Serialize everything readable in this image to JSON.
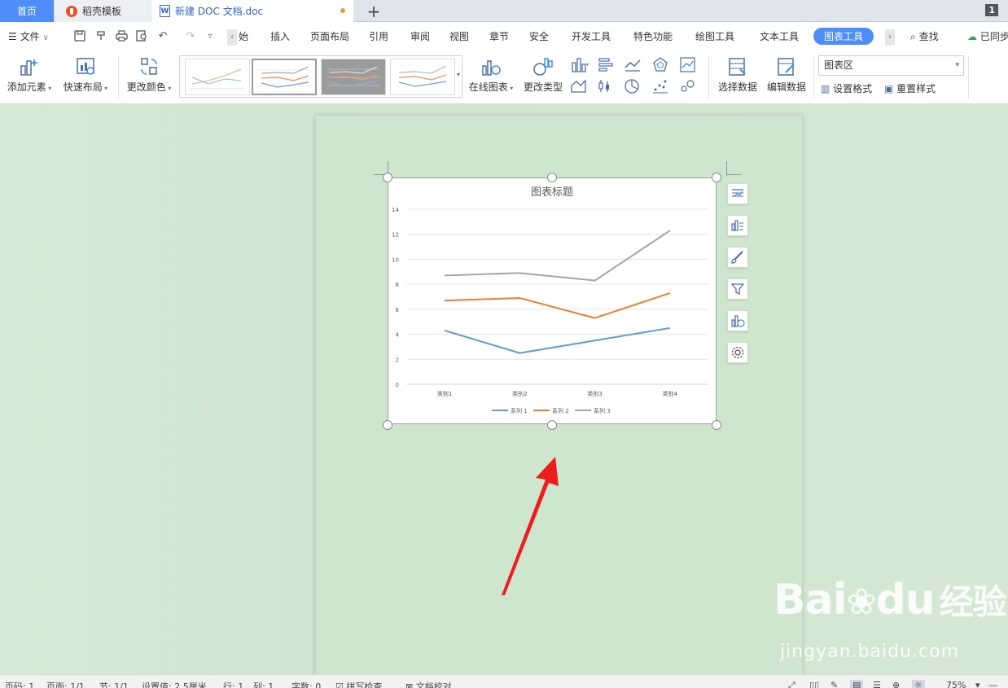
{
  "tabs": {
    "home": "首页",
    "template": "稻壳模板",
    "document": "新建 DOC 文档.doc",
    "add": "+",
    "window_count": "1"
  },
  "menu": {
    "file": "文件",
    "items": [
      "始",
      "插入",
      "页面布局",
      "引用",
      "审阅",
      "视图",
      "章节",
      "安全",
      "开发工具",
      "特色功能",
      "绘图工具",
      "文本工具",
      "图表工具"
    ],
    "search": "查找",
    "sync": "已同步"
  },
  "ribbon": {
    "add_element": "添加元素",
    "quick_layout": "快速布局",
    "change_color": "更改颜色",
    "online_chart": "在线图表",
    "change_type": "更改类型",
    "select_data": "选择数据",
    "edit_data": "编辑数据",
    "chart_area_select": "图表区",
    "set_format": "设置格式",
    "reset_style": "重置样式"
  },
  "chart_data": {
    "type": "line",
    "title": "图表标题",
    "categories": [
      "类别1",
      "类别2",
      "类别3",
      "类别4"
    ],
    "series": [
      {
        "name": "系列 1",
        "values": [
          4.3,
          2.5,
          3.5,
          4.5
        ],
        "color": "#5b9bd5"
      },
      {
        "name": "系列 2",
        "values": [
          6.7,
          6.9,
          5.3,
          7.3
        ],
        "color": "#ed7d31"
      },
      {
        "name": "系列 3",
        "values": [
          8.7,
          8.9,
          8.3,
          12.3
        ],
        "color": "#a5a5a5"
      }
    ],
    "ylim": [
      0,
      14
    ],
    "yticks": [
      "0",
      "2",
      "4",
      "6",
      "8",
      "10",
      "12",
      "14"
    ],
    "grid": true,
    "legend": "bottom"
  },
  "watermark": {
    "brand": "Bai",
    "brand2": "du",
    "suffix": "经验",
    "url": "jingyan.baidu.com"
  },
  "status": {
    "section_count": "页码: 1",
    "page": "页面: 1/1",
    "section": "节: 1/1",
    "setting": "设置值: 2.5厘米",
    "row": "行: 1",
    "col": "列: 1",
    "words": "字数: 0",
    "spell": "拼写检查",
    "proof": "文档校对",
    "zoom": "75%"
  },
  "colors": {
    "accent": "#4e8cf7",
    "page": "#cde6cd",
    "arrow": "#ee1c1c"
  }
}
